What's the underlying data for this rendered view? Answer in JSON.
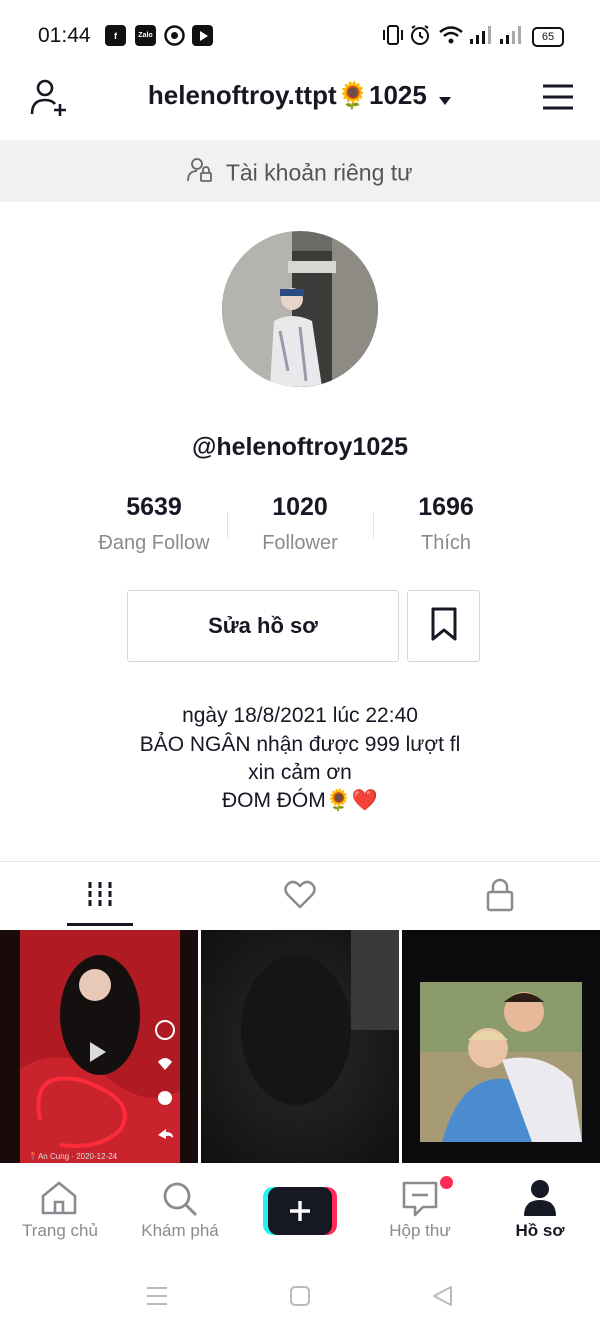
{
  "status_bar": {
    "time": "01:44",
    "battery": "65",
    "notif_icons": [
      "facebook-icon",
      "zalo-icon",
      "chrome-icon",
      "youtube-icon"
    ],
    "zalo_label": "Zalo"
  },
  "header": {
    "username": "helenoftroy.ttpt🌻1025"
  },
  "private_notice": "Tài khoản riêng tư",
  "profile": {
    "handle": "@helenoftroy1025"
  },
  "stats": [
    {
      "value": "5639",
      "label": "Đang Follow"
    },
    {
      "value": "1020",
      "label": "Follower"
    },
    {
      "value": "1696",
      "label": "Thích"
    }
  ],
  "actions": {
    "edit_label": "Sửa hồ sơ"
  },
  "bio": [
    "ngày 18/8/2021 lúc 22:40",
    "BẢO NGÂN nhận được 999 lượt fl",
    "xin cảm ơn",
    "ĐOM ĐÓM🌻❤️"
  ],
  "videos": [
    {
      "caption": "📍An Cung · 2020-12-24"
    },
    {
      "caption": ""
    },
    {
      "caption": ""
    }
  ],
  "bottom_nav": [
    {
      "label": "Trang chủ"
    },
    {
      "label": "Khám phá"
    },
    {
      "label": ""
    },
    {
      "label": "Hộp thư"
    },
    {
      "label": "Hồ sơ"
    }
  ],
  "colors": {
    "accent_red": "#fe2c55",
    "accent_cyan": "#25f4ee",
    "text": "#161823",
    "muted": "#8a8b91"
  }
}
